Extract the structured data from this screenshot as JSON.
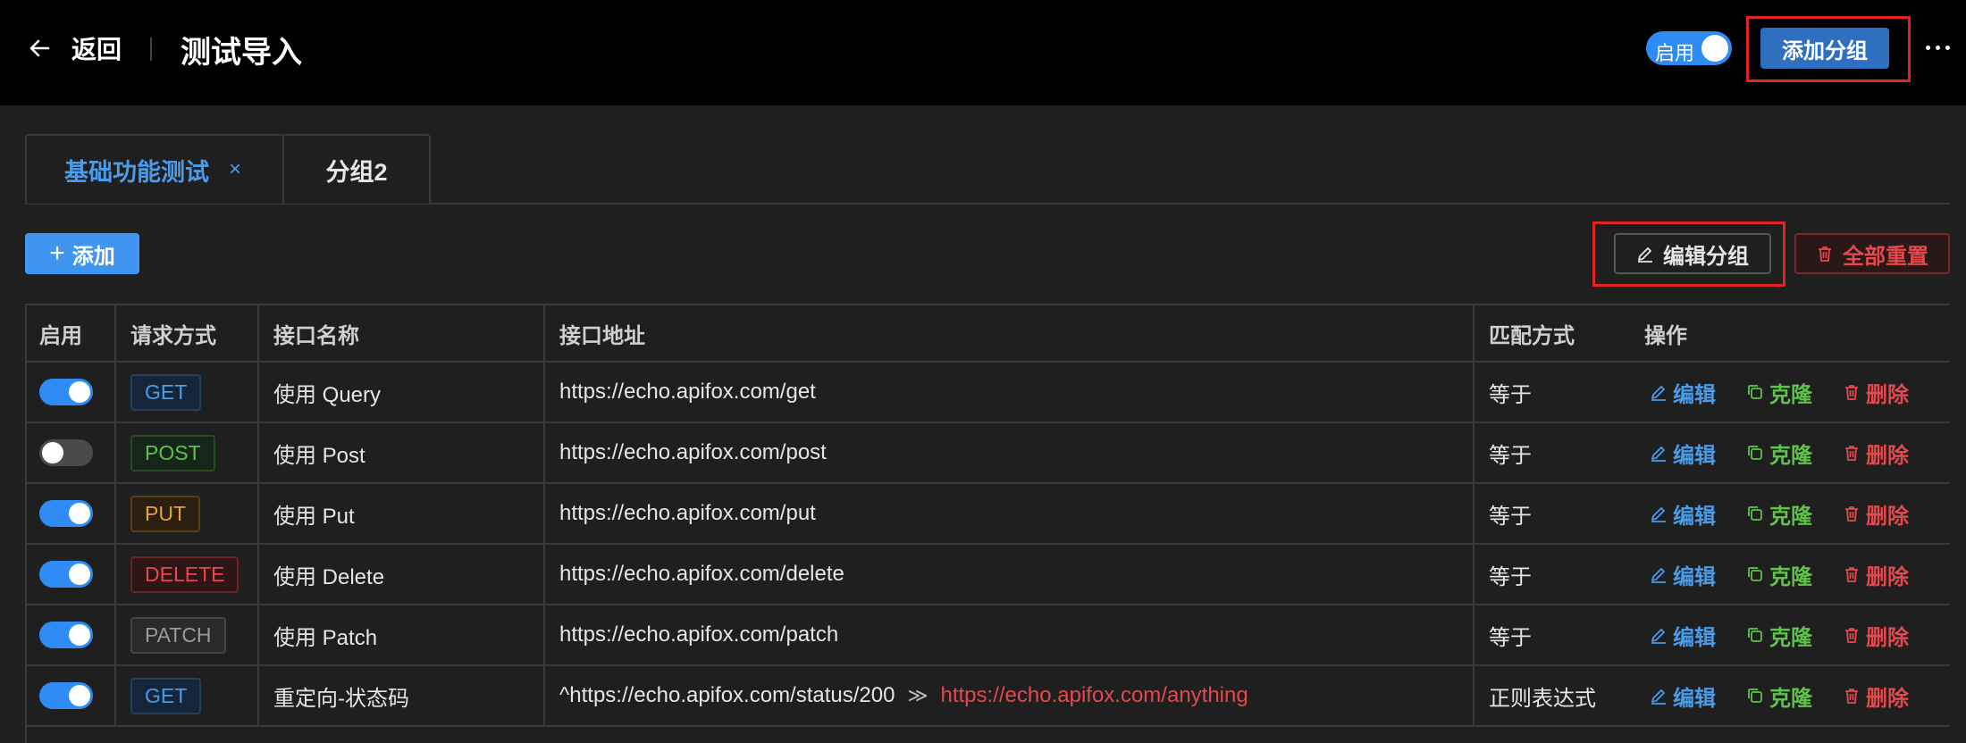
{
  "header": {
    "back_label": "返回",
    "title": "测试导入",
    "enable_label": "启用",
    "add_group_label": "添加分组"
  },
  "tabs": [
    {
      "label": "基础功能测试",
      "close": "×",
      "active": true
    },
    {
      "label": "分组2",
      "active": false
    }
  ],
  "toolbar": {
    "add_label": "添加",
    "edit_group_label": "编辑分组",
    "reset_all_label": "全部重置"
  },
  "table": {
    "headers": [
      "启用",
      "请求方式",
      "接口名称",
      "接口地址",
      "匹配方式",
      "操作"
    ],
    "actions": {
      "edit": "编辑",
      "clone": "克隆",
      "delete": "删除"
    },
    "rows": [
      {
        "enabled": true,
        "method": "GET",
        "name": "使用 Query",
        "url": "https://echo.apifox.com/get",
        "match": "等于"
      },
      {
        "enabled": false,
        "method": "POST",
        "name": "使用 Post",
        "url": "https://echo.apifox.com/post",
        "match": "等于"
      },
      {
        "enabled": true,
        "method": "PUT",
        "name": "使用 Put",
        "url": "https://echo.apifox.com/put",
        "match": "等于"
      },
      {
        "enabled": true,
        "method": "DELETE",
        "name": "使用 Delete",
        "url": "https://echo.apifox.com/delete",
        "match": "等于"
      },
      {
        "enabled": true,
        "method": "PATCH",
        "name": "使用 Patch",
        "url": "https://echo.apifox.com/patch",
        "match": "等于"
      },
      {
        "enabled": true,
        "method": "GET",
        "name": "重定向-状态码",
        "url": "^https://echo.apifox.com/status/200",
        "arrow": "≫",
        "redirect": "https://echo.apifox.com/anything",
        "match": "正则表达式"
      }
    ]
  },
  "colors": {
    "accent": "#2f8cf5",
    "danger": "#e5484d",
    "success": "#5fc24a",
    "highlight": "#e02424"
  }
}
